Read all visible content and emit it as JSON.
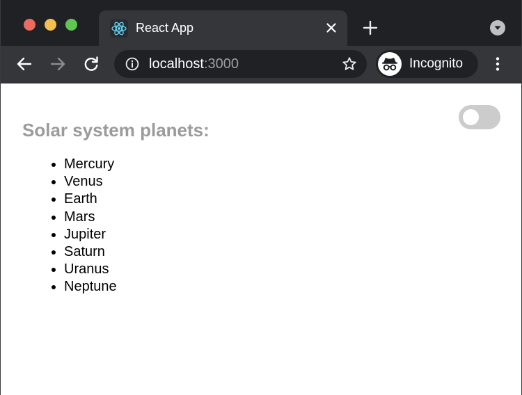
{
  "browser": {
    "tab": {
      "title": "React App",
      "favicon": "react-logo-icon"
    },
    "omnibox": {
      "host": "localhost",
      "port": ":3000"
    },
    "profile": {
      "label": "Incognito",
      "icon": "incognito-icon"
    },
    "colors": {
      "tabstrip": "#202124",
      "toolbar": "#35363a",
      "react_blue": "#61dafb"
    }
  },
  "page": {
    "heading": "Solar system planets:",
    "toggle": {
      "checked": false
    },
    "planets": [
      "Mercury",
      "Venus",
      "Earth",
      "Mars",
      "Jupiter",
      "Saturn",
      "Uranus",
      "Neptune"
    ],
    "colors": {
      "heading": "#9b9b9b",
      "toggle_track": "#cccccc"
    }
  }
}
